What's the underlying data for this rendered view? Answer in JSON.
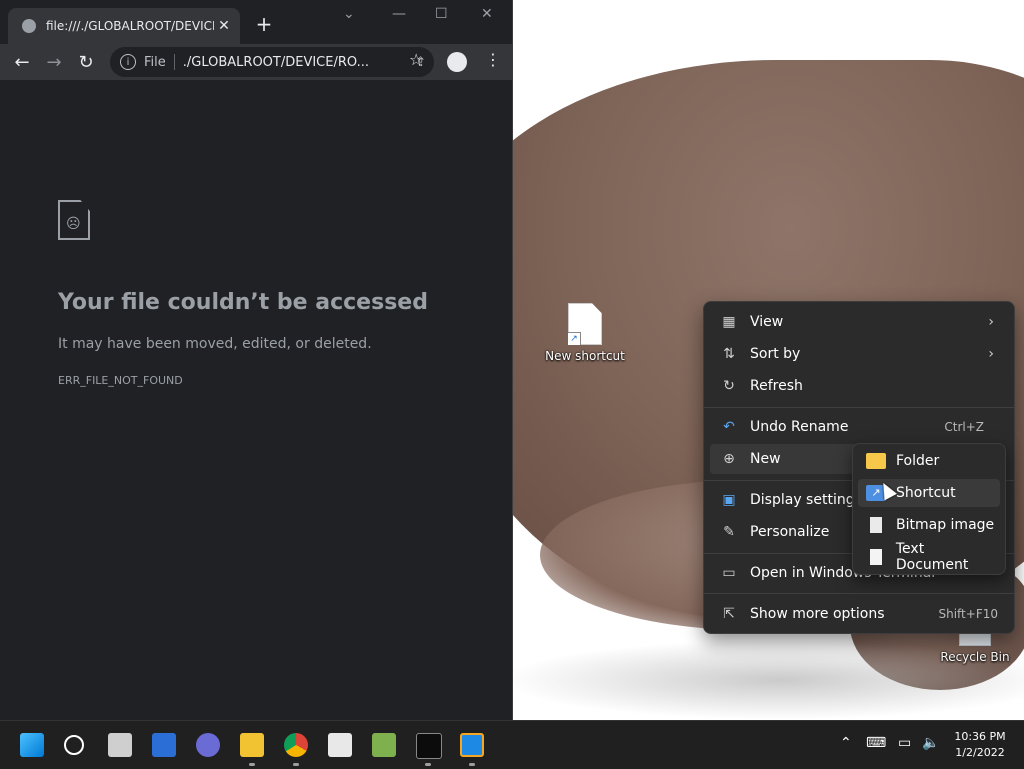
{
  "browser": {
    "tab_title": "file:///./GLOBALROOT/DEVICE/R",
    "url_prefix": "File",
    "url": "./GLOBALROOT/DEVICE/RO...",
    "error_title": "Your file couldn’t be accessed",
    "error_desc": "It may have been moved, edited, or deleted.",
    "error_code": "ERR_FILE_NOT_FOUND"
  },
  "desktop": {
    "icons": [
      {
        "label": "New shortcut"
      },
      {
        "label": "Recycle Bin"
      }
    ]
  },
  "context_menu": {
    "items": [
      {
        "label": "View",
        "icon": "view-grid-icon",
        "submenu": true
      },
      {
        "label": "Sort by",
        "icon": "sort-icon",
        "submenu": true
      },
      {
        "label": "Refresh",
        "icon": "refresh-icon"
      },
      {
        "label": "Undo Rename",
        "icon": "undo-icon",
        "shortcut": "Ctrl+Z"
      },
      {
        "label": "New",
        "icon": "new-plus-icon",
        "submenu": true
      },
      {
        "label": "Display settings",
        "icon": "display-icon"
      },
      {
        "label": "Personalize",
        "icon": "brush-icon"
      },
      {
        "label": "Open in Windows Terminal",
        "icon": "terminal-icon"
      },
      {
        "label": "Show more options",
        "icon": "share-icon",
        "shortcut": "Shift+F10"
      }
    ],
    "submenu_new": [
      {
        "label": "Folder",
        "icon": "folder-icon"
      },
      {
        "label": "Shortcut",
        "icon": "shortcut-icon"
      },
      {
        "label": "Bitmap image",
        "icon": "bitmap-icon"
      },
      {
        "label": "Text Document",
        "icon": "text-document-icon"
      }
    ]
  },
  "taskbar": {
    "time": "10:36 PM",
    "date": "1/2/2022",
    "apps": [
      "start",
      "search",
      "task-view",
      "widgets",
      "teams-chat",
      "file-explorer",
      "chrome",
      "store",
      "installer",
      "terminal",
      "virtualbox"
    ]
  }
}
